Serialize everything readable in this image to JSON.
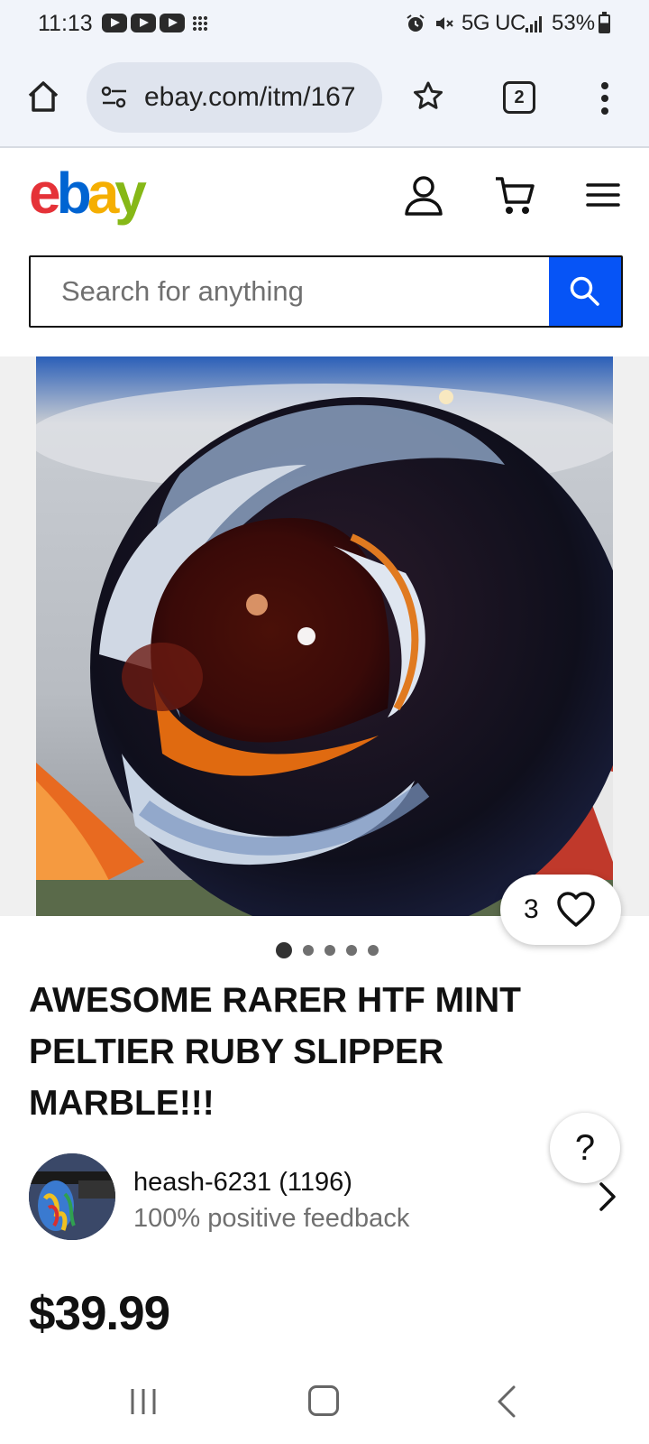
{
  "status_bar": {
    "time": "11:13",
    "network": "5G UC",
    "battery": "53%"
  },
  "browser": {
    "url": "ebay.com/itm/167",
    "tab_count": "2"
  },
  "ebay": {
    "logo_letters": [
      "e",
      "b",
      "a",
      "y"
    ],
    "logo_colors": [
      "#e53238",
      "#0064d2",
      "#f5af02",
      "#86b817"
    ],
    "search_placeholder": "Search for anything",
    "search_button_color": "#0654f6"
  },
  "listing": {
    "watch_count": "3",
    "image_dots": 5,
    "active_image": 1,
    "title": "AWESOME RARER HTF MINT PELTIER RUBY SLIPPER MARBLE!!!",
    "seller_name": "heash-6231 (1196)",
    "seller_feedback": "100% positive feedback",
    "price": "$39.99"
  },
  "help_label": "?"
}
